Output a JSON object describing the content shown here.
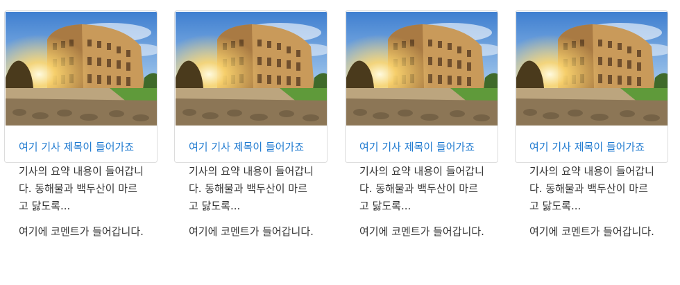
{
  "cards": [
    {
      "title": "여기 기사 제목이 들어가죠",
      "summary": "기사의 요약 내용이 들어갑니다. 동해물과 백두산이 마르고 닳도록...",
      "comment": "여기에 코멘트가 들어갑니다.",
      "image": "colosseum-photo"
    },
    {
      "title": "여기 기사 제목이 들어가죠",
      "summary": "기사의 요약 내용이 들어갑니다. 동해물과 백두산이 마르고 닳도록...",
      "comment": "여기에 코멘트가 들어갑니다.",
      "image": "colosseum-photo"
    },
    {
      "title": "여기 기사 제목이 들어가죠",
      "summary": "기사의 요약 내용이 들어갑니다. 동해물과 백두산이 마르고 닳도록...",
      "comment": "여기에 코멘트가 들어갑니다.",
      "image": "colosseum-photo"
    },
    {
      "title": "여기 기사 제목이 들어가죠",
      "summary": "기사의 요약 내용이 들어갑니다. 동해물과 백두산이 마르고 닳도록...",
      "comment": "여기에 코멘트가 들어갑니다.",
      "image": "colosseum-photo"
    }
  ],
  "colors": {
    "title_link": "#1f7ad0",
    "body_text": "#333333",
    "card_border": "#dcdcdc"
  }
}
